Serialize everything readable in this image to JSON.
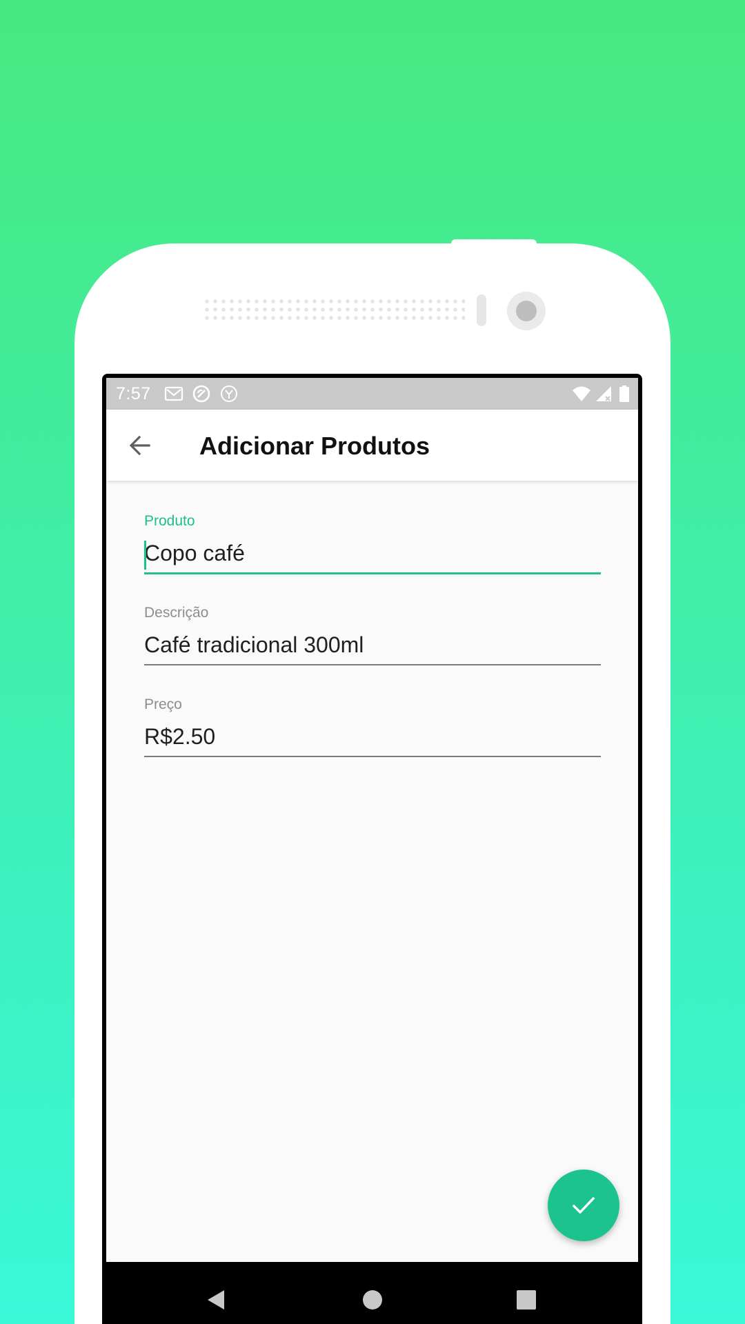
{
  "status_bar": {
    "time": "7:57",
    "icons": [
      "gmail-icon",
      "sync-icon",
      "vpn-icon",
      "wifi-icon",
      "signal-icon",
      "battery-icon"
    ]
  },
  "toolbar": {
    "back_icon": "arrow-back-icon",
    "title": "Adicionar Produtos"
  },
  "form": {
    "produto": {
      "label": "Produto",
      "value": "Copo café"
    },
    "descricao": {
      "label": "Descrição",
      "value": "Café tradicional 300ml"
    },
    "preco": {
      "label": "Preço",
      "value": "R$2.50"
    }
  },
  "fab": {
    "icon": "check-icon"
  },
  "nav": {
    "icons": [
      "nav-back-icon",
      "nav-home-icon",
      "nav-recents-icon"
    ]
  },
  "colors": {
    "accent": "#1dbf8a",
    "status_bar": "#c9c9c9",
    "background_top": "#46e97f",
    "background_bottom": "#3af8d8"
  }
}
